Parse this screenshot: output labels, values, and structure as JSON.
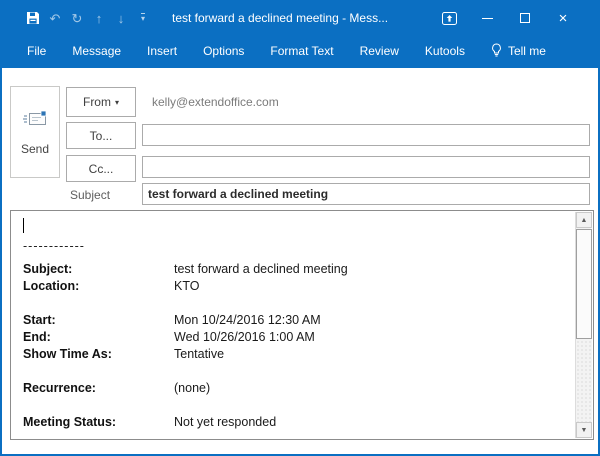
{
  "colors": {
    "titlebar_blue": "#0b6fc2",
    "window_border": "#0b6fc2",
    "field_border": "#ababab",
    "body_border": "#8c8c8c",
    "muted_text": "#7b7b7b"
  },
  "titlebar": {
    "title": "test forward a declined meeting - Mess...",
    "qat_icons": [
      "save",
      "undo",
      "redo",
      "move-up",
      "move-down",
      "customize-quick-access"
    ]
  },
  "icons": {
    "undo": "↶",
    "redo": "↻",
    "move_up": "↑",
    "move_down": "↓",
    "qat_more": "▾",
    "from_dropdown": "▾",
    "close": "×",
    "scroll_up": "▲",
    "scroll_down": "▼"
  },
  "ribbon": {
    "tabs": [
      "File",
      "Message",
      "Insert",
      "Options",
      "Format Text",
      "Review",
      "Kutools"
    ],
    "tell_me": "Tell me"
  },
  "form": {
    "send_label": "Send",
    "from_label": "From",
    "from_value": "kelly@extendoffice.com",
    "to_label": "To...",
    "to_value": "",
    "cc_label": "Cc...",
    "cc_value": "",
    "subject_label": "Subject",
    "subject_value": "test forward a declined meeting"
  },
  "body": {
    "separator": "------------",
    "details": [
      {
        "label": "Subject:",
        "value": "test forward a declined meeting"
      },
      {
        "label": "Location:",
        "value": "KTO"
      },
      {
        "label": "Start:",
        "value": "Mon 10/24/2016 12:30 AM"
      },
      {
        "label": "End:",
        "value": "Wed 10/26/2016 1:00 AM"
      },
      {
        "label": "Show Time As:",
        "value": "Tentative"
      },
      {
        "label": "Recurrence:",
        "value": "(none)"
      },
      {
        "label": "Meeting Status:",
        "value": "Not yet responded"
      }
    ]
  }
}
